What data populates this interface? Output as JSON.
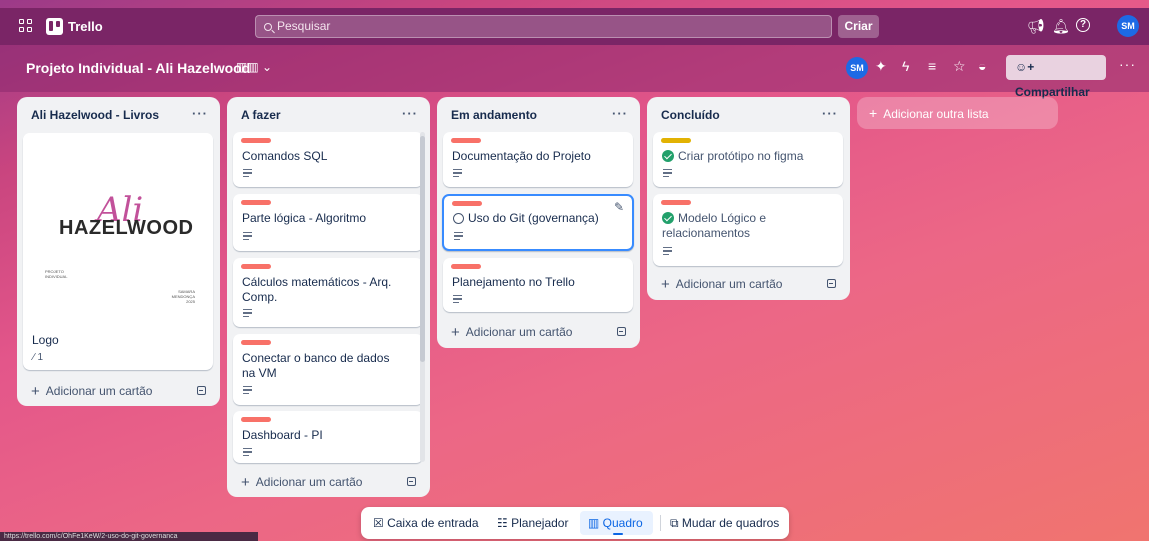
{
  "topbar": {
    "brand": "Trello",
    "search_placeholder": "Pesquisar",
    "create_label": "Criar",
    "avatar_initials": "SM"
  },
  "board": {
    "title": "Projeto Individual - Ali Hazelwood",
    "member_initials": "SM",
    "share_label": "Compartilhar"
  },
  "lists": [
    {
      "title": "Ali Hazelwood - Livros",
      "cards": [
        {
          "title": "Logo",
          "attachments": "1",
          "cover": {
            "wordmark": "HAZELWOOD",
            "script": "Ali",
            "fine_left": "PROJETO INDIVIDUAL",
            "fine_right": "SAMARA MENDONÇA 2025"
          }
        }
      ],
      "add_card": "Adicionar um cartão"
    },
    {
      "title": "A fazer",
      "cards": [
        {
          "title": "Comandos SQL",
          "label_color": "#f87168"
        },
        {
          "title": "Parte lógica - Algoritmo",
          "label_color": "#f87168"
        },
        {
          "title": "Cálculos matemáticos - Arq. Comp.",
          "label_color": "#f87168"
        },
        {
          "title": "Conectar o banco de dados na VM",
          "label_color": "#f87168"
        },
        {
          "title": "Dashboard - PI",
          "label_color": "#f87168"
        }
      ],
      "add_card": "Adicionar um cartão"
    },
    {
      "title": "Em andamento",
      "cards": [
        {
          "title": "Documentação do Projeto",
          "label_color": "#f87168"
        },
        {
          "title": "Uso do Git (governança)",
          "label_color": "#f87168"
        },
        {
          "title": "Planejamento no Trello",
          "label_color": "#f87168"
        }
      ],
      "add_card": "Adicionar um cartão"
    },
    {
      "title": "Concluído",
      "cards": [
        {
          "title": "Criar protótipo no figma",
          "label_color": "#e2b203"
        },
        {
          "title": "Modelo Lógico e relacionamentos",
          "label_color": "#f87168"
        }
      ],
      "add_card": "Adicionar um cartão"
    }
  ],
  "add_list": "Adicionar outra lista",
  "bottom_nav": {
    "inbox": "Caixa de entrada",
    "planner": "Planejador",
    "board": "Quadro",
    "switch": "Mudar de quadros"
  },
  "status_url": "https://trello.com/c/OhFe1KeW/2-uso-do-git-governanca",
  "colors": {
    "header": "#7a2566",
    "label_red": "#f87168",
    "label_yellow": "#e2b203",
    "check_green": "#22a06b",
    "accent_blue": "#0c66e4"
  }
}
